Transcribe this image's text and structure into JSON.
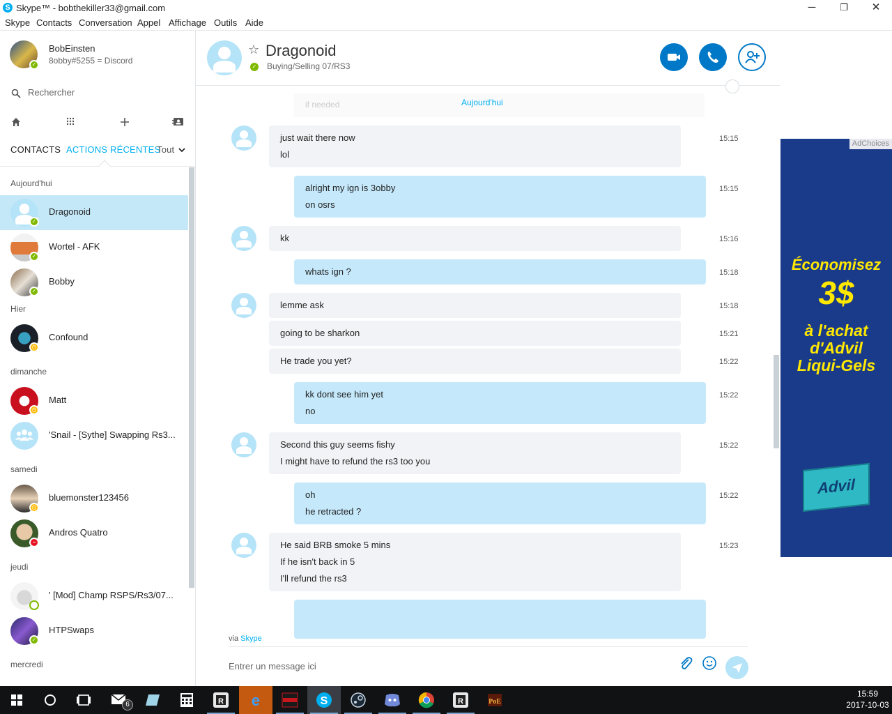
{
  "window": {
    "title": "Skype™ - bobthekiller33@gmail.com",
    "minimize": "─",
    "maximize": "❐",
    "close": "✕"
  },
  "menu": [
    "Skype",
    "Contacts",
    "Conversation",
    "Appel",
    "Affichage",
    "Outils",
    "Aide"
  ],
  "profile": {
    "name": "BobEinsten",
    "mood": "8obby#5255 = Discord",
    "status": "online"
  },
  "search": {
    "placeholder": "Rechercher"
  },
  "tabs": {
    "contacts": "CONTACTS",
    "recent": "ACTIONS RÉCENTES",
    "filter": "Tout"
  },
  "recents": {
    "sections": [
      "Aujourd'hui",
      "Hier",
      "dimanche",
      "samedi",
      "jeudi",
      "mercredi"
    ],
    "items": [
      {
        "name": "Dragonoid",
        "status": "online",
        "selected": true
      },
      {
        "name": "Wortel - AFK",
        "status": "online"
      },
      {
        "name": "Bobby",
        "status": "online"
      },
      {
        "name": "Confound",
        "status": "away"
      },
      {
        "name": "Matt",
        "status": "away"
      },
      {
        "name": "'Snail - [Sythe] Swapping Rs3...",
        "status": "group"
      },
      {
        "name": "bluemonster123456",
        "status": "away"
      },
      {
        "name": "Andros Quatro",
        "status": "dnd"
      },
      {
        "name": "' [Mod] Champ RSPS/Rs3/07...",
        "status": "offline"
      },
      {
        "name": "HTPSwaps",
        "status": "online"
      }
    ]
  },
  "chat": {
    "contact": "Dragonoid",
    "mood": "Buying/Selling 07/RS3",
    "day_label": "Aujourd'hui",
    "ghost_text": "if needed",
    "messages": [
      {
        "dir": "in",
        "lines": [
          "just wait there now",
          "lol"
        ],
        "time": "15:15",
        "avatar": true
      },
      {
        "dir": "out",
        "lines": [
          "alright my ign is 3obby",
          "on osrs"
        ],
        "time": "15:15"
      },
      {
        "dir": "in",
        "lines": [
          "kk"
        ],
        "time": "15:16",
        "avatar": true
      },
      {
        "dir": "out",
        "lines": [
          "whats ign ?"
        ],
        "time": "15:18"
      },
      {
        "dir": "in",
        "lines": [
          "lemme ask"
        ],
        "time": "15:18",
        "avatar": true
      },
      {
        "dir": "in",
        "lines": [
          "going to be sharkon"
        ],
        "time": "15:21"
      },
      {
        "dir": "in",
        "lines": [
          "He trade you yet?"
        ],
        "time": "15:22"
      },
      {
        "dir": "out",
        "lines": [
          "kk dont see him yet",
          "no"
        ],
        "time": "15:22"
      },
      {
        "dir": "in",
        "lines": [
          "Second this guy seems fishy",
          "I might have to refund the rs3 too you"
        ],
        "time": "15:22",
        "avatar": true
      },
      {
        "dir": "out",
        "lines": [
          "oh",
          "he retracted ?"
        ],
        "time": "15:22"
      },
      {
        "dir": "in",
        "lines": [
          "He said BRB smoke 5 mins",
          "If he isn't back in 5",
          "I'll refund the rs3"
        ],
        "time": "15:23",
        "avatar": true
      }
    ],
    "via": "via",
    "via_brand": "Skype",
    "compose_placeholder": "Entrer un message ici"
  },
  "ad": {
    "adchoices": "AdChoices",
    "headline": "Économisez",
    "amount": "3$",
    "subtitle_lines": [
      "à l'achat",
      "d'Advil",
      "Liqui-Gels"
    ],
    "product": "Advil",
    "colors": {
      "bg": "#1a3a8a",
      "text": "#ffe800"
    }
  },
  "taskbar": {
    "mail_badge": "6",
    "time": "15:59",
    "date": "2017-10-03"
  },
  "colors": {
    "accent": "#00aff0",
    "call_button": "#0078c8",
    "selected_row": "#c5e8f8",
    "outgoing_bubble": "#c5e9fb"
  }
}
